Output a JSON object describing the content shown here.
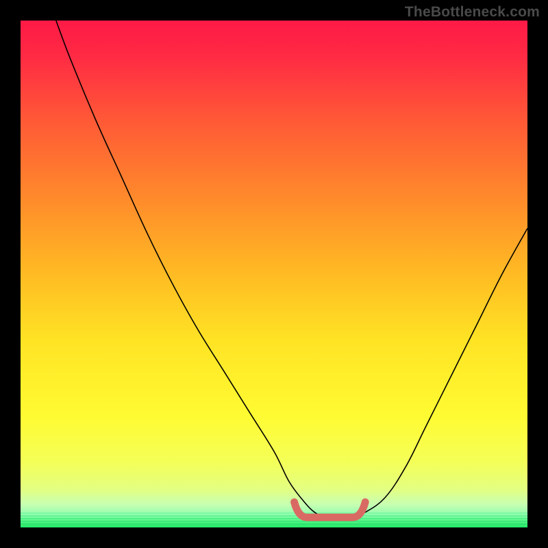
{
  "watermark": "TheBottleneck.com",
  "colors": {
    "black": "#000000",
    "gradient_top": "#fe1a46",
    "gradient_mid1": "#ff7d2e",
    "gradient_mid2": "#ffe324",
    "gradient_low": "#f8ff58",
    "green": "#2cf56a",
    "curve": "#000000",
    "marker": "#d96a63"
  },
  "chart_data": {
    "type": "line",
    "title": "",
    "xlabel": "",
    "ylabel": "",
    "xlim": [
      0,
      100
    ],
    "ylim": [
      0,
      100
    ],
    "series": [
      {
        "name": "bottleneck-curve",
        "x": [
          7,
          10,
          15,
          20,
          25,
          30,
          35,
          40,
          45,
          50,
          53,
          56,
          58,
          60,
          62,
          65,
          68,
          72,
          76,
          80,
          85,
          90,
          95,
          100
        ],
        "y": [
          100,
          92,
          80,
          69,
          58,
          48,
          39,
          31,
          23,
          15,
          9,
          5,
          3,
          2,
          2,
          2,
          3,
          6,
          12,
          20,
          30,
          40,
          50,
          59
        ]
      }
    ],
    "flat_region": {
      "x_start": 54,
      "x_end": 68,
      "y": 2
    },
    "annotations": [
      {
        "text": "TheBottleneck.com",
        "position": "top-right"
      }
    ]
  }
}
